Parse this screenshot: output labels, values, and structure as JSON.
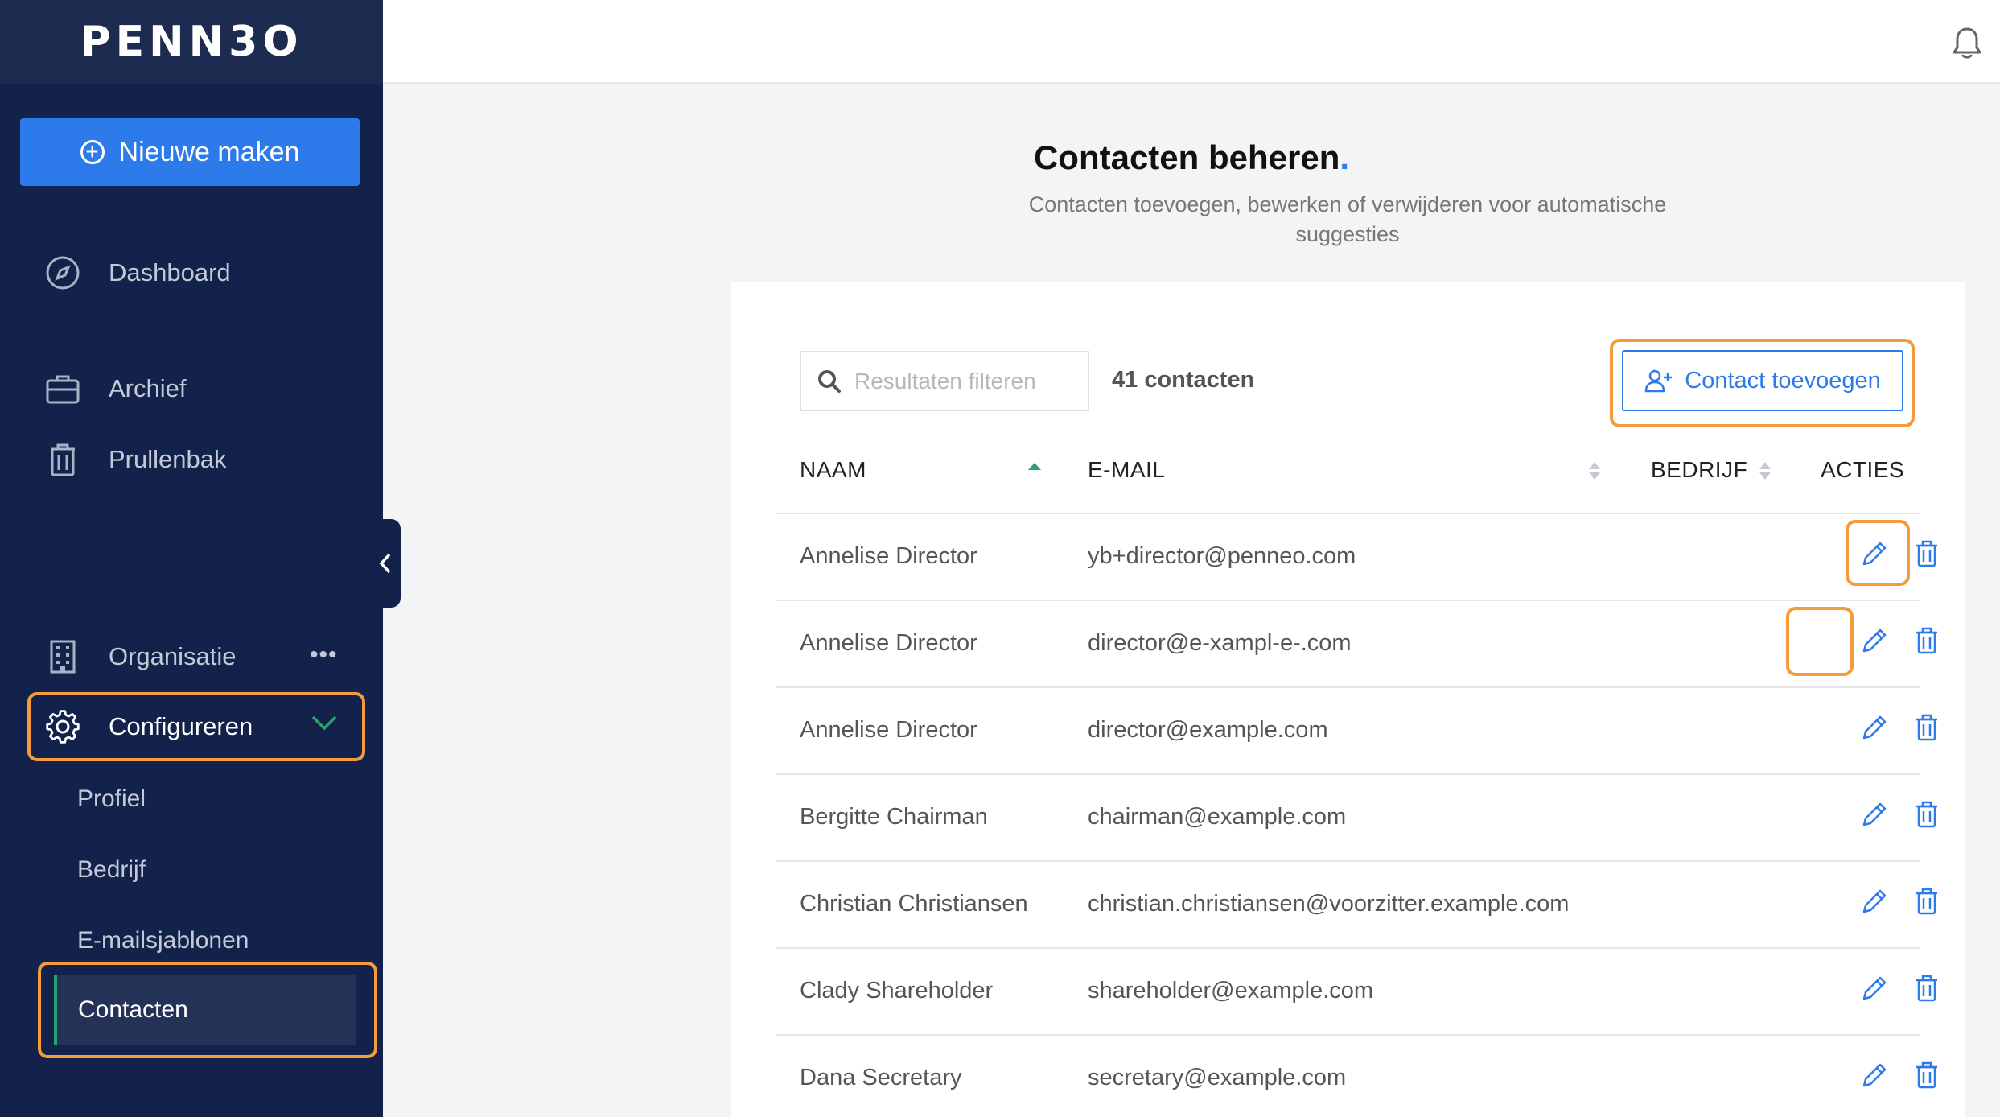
{
  "app": {
    "logo": "PENN3O"
  },
  "sidebar": {
    "new_button": "Nieuwe maken",
    "items": [
      {
        "label": "Dashboard",
        "icon": "compass-icon"
      },
      {
        "label": "Archief",
        "icon": "briefcase-icon"
      },
      {
        "label": "Prullenbak",
        "icon": "trash-icon"
      },
      {
        "label": "Organisatie",
        "icon": "building-icon"
      },
      {
        "label": "Configureren",
        "icon": "gear-icon"
      }
    ],
    "more": "•••",
    "subitems": [
      {
        "label": "Profiel"
      },
      {
        "label": "Bedrijf"
      },
      {
        "label": "E-mailsjablonen"
      },
      {
        "label": "Contacten"
      }
    ]
  },
  "page": {
    "title": "Contacten beheren",
    "title_dot": ".",
    "subtitle": "Contacten toevoegen, bewerken of verwijderen voor automatische suggesties"
  },
  "toolbar": {
    "search_placeholder": "Resultaten filteren",
    "count": "41 contacten",
    "add_button": "Contact toevoegen"
  },
  "table": {
    "columns": [
      "NAAM",
      "E-MAIL",
      "BEDRIJF",
      "ACTIES"
    ],
    "rows": [
      {
        "name": "Annelise Director",
        "email": "yb+director@penneo.com"
      },
      {
        "name": "Annelise Director",
        "email": "director@e-xampl-e-.com"
      },
      {
        "name": "Annelise Director",
        "email": "director@example.com"
      },
      {
        "name": "Bergitte Chairman",
        "email": "chairman@example.com"
      },
      {
        "name": "Christian Christiansen",
        "email": "christian.christiansen@voorzitter.example.com"
      },
      {
        "name": "Clady Shareholder",
        "email": "shareholder@example.com"
      },
      {
        "name": "Dana Secretary",
        "email": "secretary@example.com"
      }
    ]
  },
  "colors": {
    "sidebar": "#13224a",
    "accent": "#2d7bea",
    "highlight": "#f39c3c",
    "active_bar": "#2aa16e"
  }
}
